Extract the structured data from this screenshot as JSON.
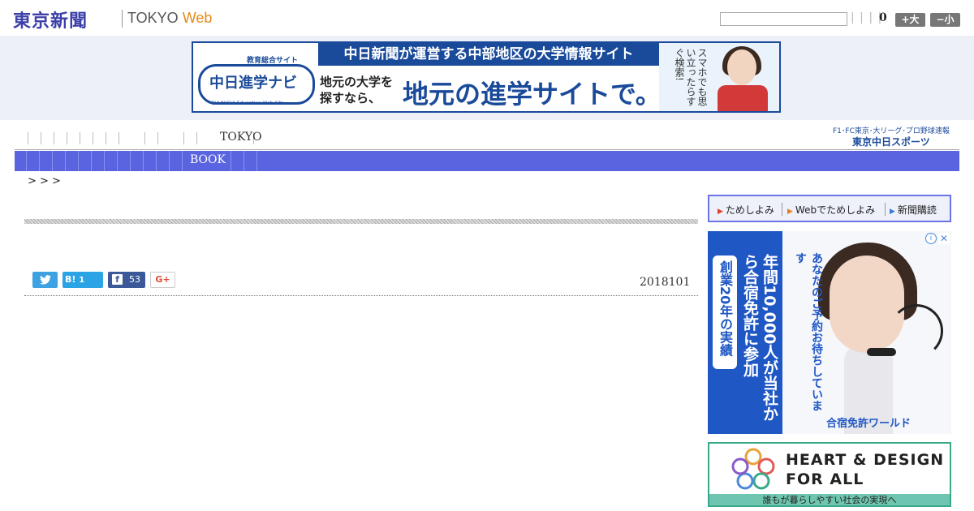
{
  "header": {
    "logo_jp": "東京新聞",
    "logo_en_prefix": "TOKYO",
    "logo_en_suffix": "Web",
    "search_placeholder": "",
    "dividers": "| | | |",
    "count": "0",
    "font_larger": "+大",
    "font_smaller": "−小"
  },
  "top_ad": {
    "label_small": "教育総合サイト",
    "navi_logo": "中日進学ナビ",
    "navi_sub": "CHUNICHI Education Web Site",
    "headline": "中日新聞が運営する中部地区の大学情報サイト",
    "body_left": "地元の大学を探すなら、",
    "body_main": "地元の進学サイトで。",
    "side_text": "スマホでも思い立ったらすぐ検索!"
  },
  "nav": {
    "primary_label": "TOKYO",
    "secondary_label": "BOOK",
    "chunichi_top": "F1･FC東京･大リーグ･プロ野球速報",
    "chunichi_logo": "東京中日スポーツ"
  },
  "breadcrumb": ">    > >",
  "article": {
    "date": "2018101",
    "share": {
      "twitter_icon": "twitter-icon",
      "hatena_label": "B!",
      "hatena_count": "1",
      "facebook_label": "f",
      "facebook_count": "53",
      "gplus_label": "G+"
    }
  },
  "sidebar": {
    "tameshi": [
      {
        "label": "ためしよみ"
      },
      {
        "label": "Webでためしよみ"
      },
      {
        "label": "新聞購読"
      }
    ],
    "ad1": {
      "badge": "創業20年の実績",
      "main": "年間10,000人が当社から合宿免許に参加",
      "sub": "あなたのご予約お待ちしています",
      "brand": "合宿免許ワールド",
      "info": "i",
      "close": "✕"
    },
    "ad2": {
      "title_line1": "HEART & DESIGN",
      "title_line2": "FOR ALL",
      "footer": "誰もが暮らしやすい社会の実現へ"
    }
  },
  "colors": {
    "brand_blue": "#3b3fa8",
    "nav_blue": "#5b64e0",
    "web_orange": "#e58a1a"
  }
}
